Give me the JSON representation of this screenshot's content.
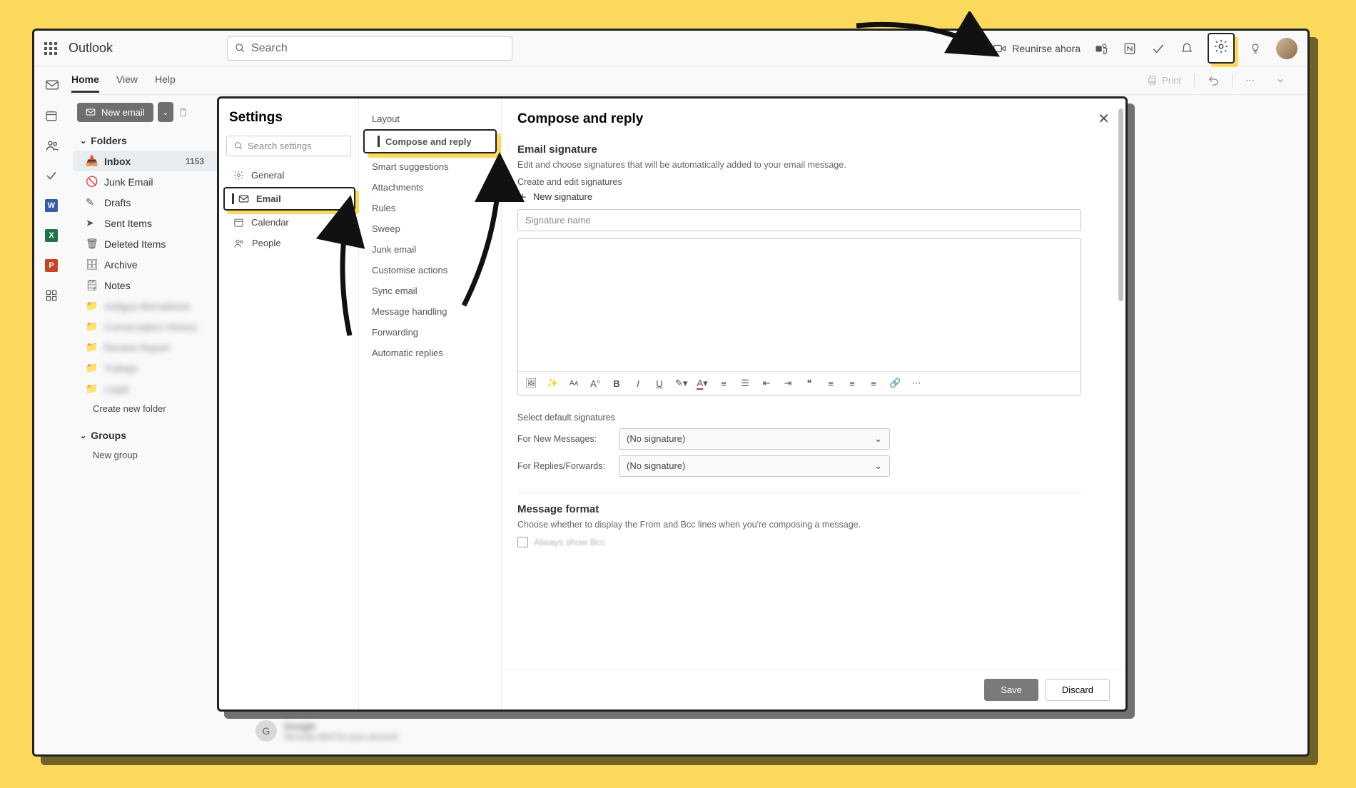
{
  "app": {
    "name": "Outlook",
    "search_placeholder": "Search"
  },
  "topbar": {
    "meet_label": "Reunirse ahora"
  },
  "nav": {
    "tabs": [
      "Home",
      "View",
      "Help"
    ],
    "active": 0
  },
  "ribbon": {
    "new_email": "New email",
    "print": "Print"
  },
  "folders": {
    "section": "Folders",
    "items": [
      {
        "icon": "inbox",
        "label": "Inbox",
        "count": "1153",
        "active": true
      },
      {
        "icon": "junk",
        "label": "Junk Email"
      },
      {
        "icon": "draft",
        "label": "Drafts"
      },
      {
        "icon": "sent",
        "label": "Sent Items"
      },
      {
        "icon": "trash",
        "label": "Deleted Items"
      },
      {
        "icon": "archive",
        "label": "Archive"
      },
      {
        "icon": "note",
        "label": "Notes"
      },
      {
        "icon": "folder",
        "label": "Antiguo Borradores",
        "blur": true
      },
      {
        "icon": "folder",
        "label": "Conversation History",
        "blur": true
      },
      {
        "icon": "folder",
        "label": "Review Report",
        "blur": true
      },
      {
        "icon": "folder",
        "label": "Trabajo",
        "blur": true
      },
      {
        "icon": "folder",
        "label": "Legal",
        "blur": true
      }
    ],
    "create": "Create new folder",
    "groups_section": "Groups",
    "new_group": "New group"
  },
  "settings": {
    "title": "Settings",
    "search_placeholder": "Search settings",
    "categories": [
      {
        "icon": "gear",
        "label": "General"
      },
      {
        "icon": "mail",
        "label": "Email",
        "active": true
      },
      {
        "icon": "calendar",
        "label": "Calendar"
      },
      {
        "icon": "people",
        "label": "People"
      }
    ],
    "subnav": [
      "Layout",
      "Compose and reply",
      "Smart suggestions",
      "Attachments",
      "Rules",
      "Sweep",
      "Junk email",
      "Customise actions",
      "Sync email",
      "Message handling",
      "Forwarding",
      "Automatic replies"
    ],
    "subnav_active": 1,
    "compose": {
      "title": "Compose and reply",
      "sig_head": "Email signature",
      "sig_desc": "Edit and choose signatures that will be automatically added to your email message.",
      "sig_create_label": "Create and edit signatures",
      "new_sig": "New signature",
      "sig_name_placeholder": "Signature name",
      "defaults_head": "Select default signatures",
      "for_new": "For New Messages:",
      "for_reply": "For Replies/Forwards:",
      "no_sig": "(No signature)",
      "msgfmt_head": "Message format",
      "msgfmt_desc": "Choose whether to display the From and Bcc lines when you're composing a message.",
      "always_bcc": "Always show Bcc"
    },
    "save": "Save",
    "discard": "Discard"
  },
  "peek": {
    "initial": "G",
    "sender": "Google",
    "subject": "Security alert for your account"
  }
}
